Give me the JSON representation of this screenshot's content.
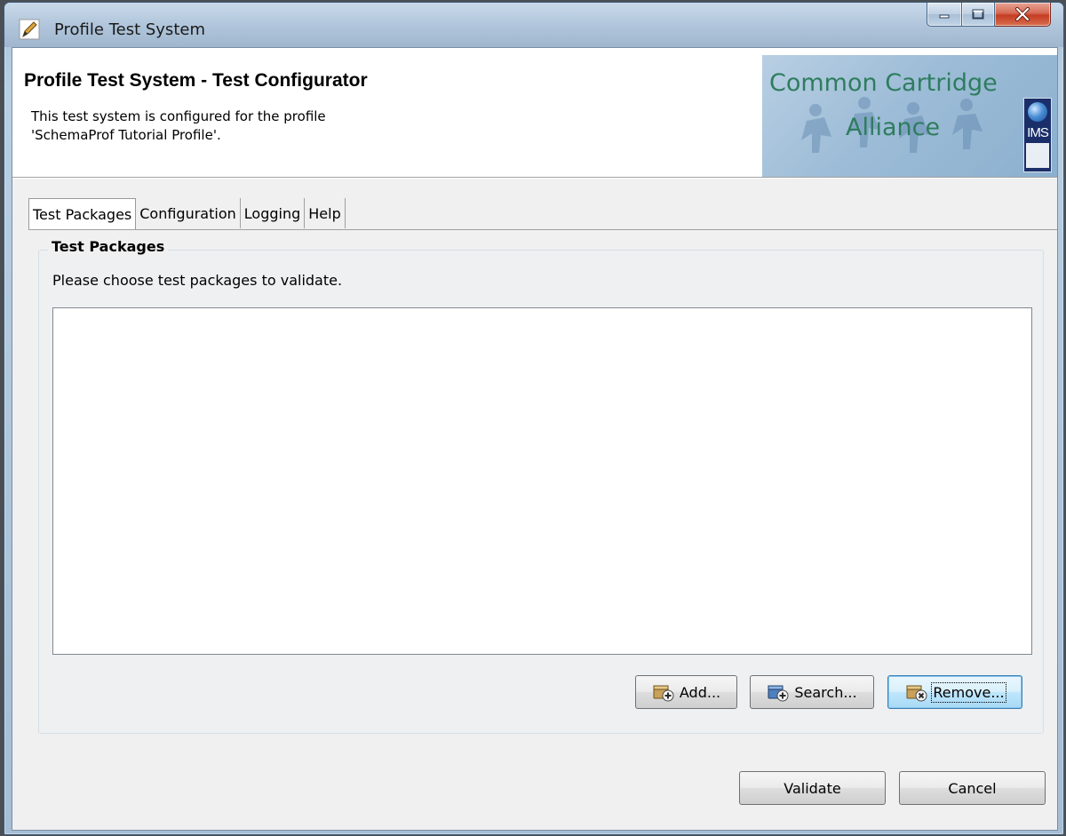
{
  "window": {
    "title": "Profile Test System",
    "controls": {
      "minimize": "minimize",
      "maximize": "maximize",
      "close": "close"
    }
  },
  "header": {
    "title": "Profile Test System - Test Configurator",
    "description": "This test system is configured for the profile\n'SchemaProf Tutorial Profile'.",
    "logo": {
      "line1": "Common Cartridge",
      "line2": "Alliance",
      "badge": "IMS"
    }
  },
  "tabs": [
    {
      "label": "Test Packages",
      "active": true
    },
    {
      "label": "Configuration",
      "active": false
    },
    {
      "label": "Logging",
      "active": false
    },
    {
      "label": "Help",
      "active": false
    }
  ],
  "test_packages": {
    "group_title": "Test Packages",
    "instructions": "Please choose test packages to validate.",
    "items": [],
    "buttons": {
      "add": "Add...",
      "search": "Search...",
      "remove": "Remove..."
    }
  },
  "footer": {
    "validate": "Validate",
    "cancel": "Cancel"
  },
  "colors": {
    "logo_text": "#2e7d5e",
    "focused_button_border": "#3c7fb1",
    "dialog_background": "#f0f0f0"
  },
  "icons": {
    "app": "pencil-icon",
    "add": "package-add-icon",
    "search": "package-search-icon",
    "remove": "package-remove-icon"
  }
}
